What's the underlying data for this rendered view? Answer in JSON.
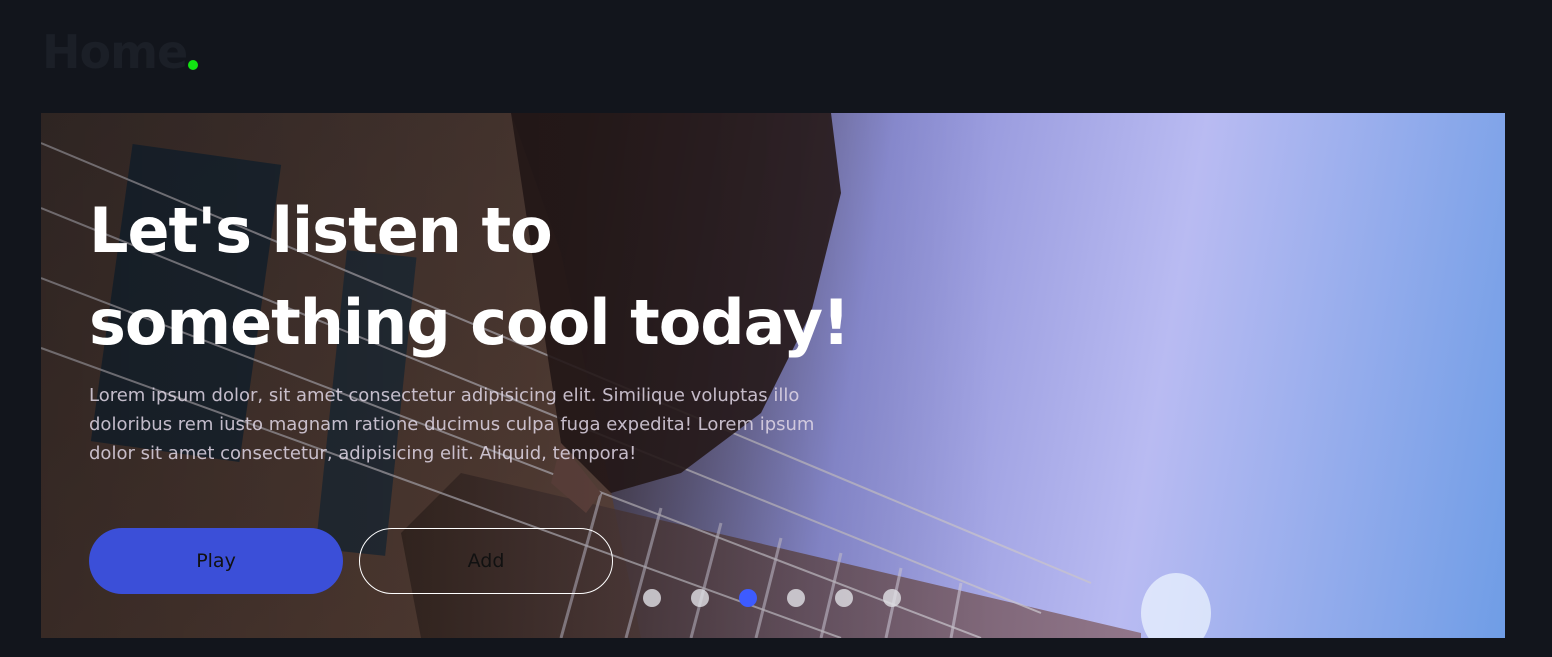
{
  "header": {
    "title": "Home",
    "accent_color": "#12e412"
  },
  "hero": {
    "heading": "Let's listen to something cool today!",
    "description": "Lorem ipsum dolor, sit amet consectetur adipisicing elit. Similique voluptas illo doloribus rem iusto magnam ratione ducimus culpa fuga expedita! Lorem ipsum dolor sit amet consectetur, adipisicing elit. Aliquid, tempora!",
    "play_label": "Play",
    "add_label": "Add",
    "play_color": "#3b4fd8"
  },
  "carousel": {
    "dot_count": 6,
    "active_index": 2,
    "active_color": "#3d5bff"
  }
}
